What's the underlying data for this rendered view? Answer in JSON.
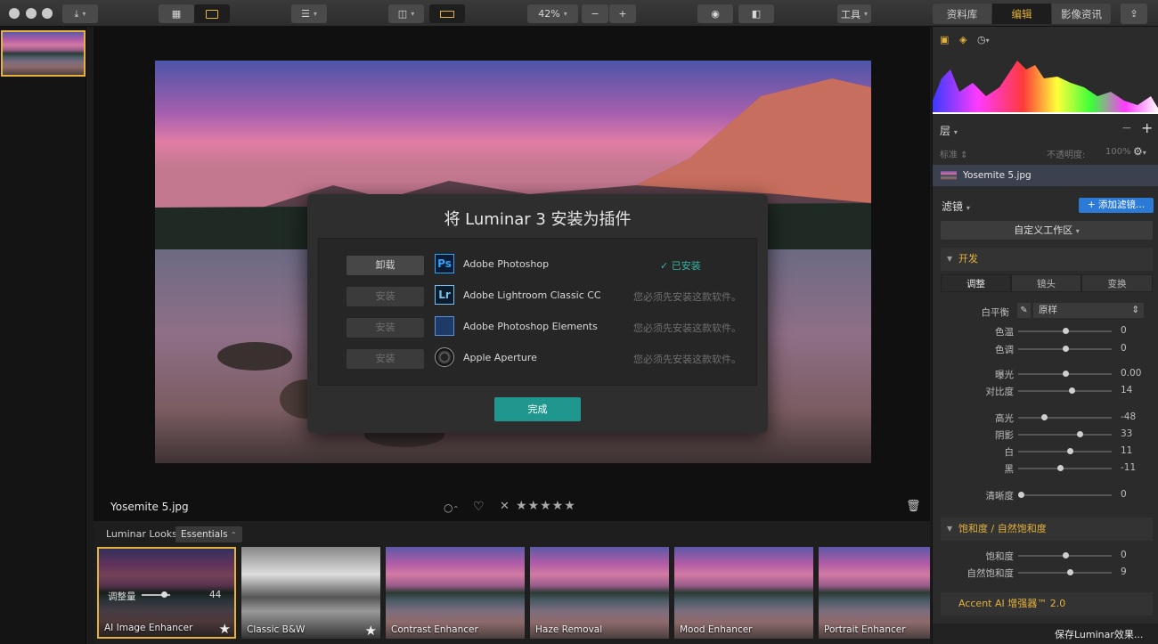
{
  "toolbar": {
    "zoom": "42%",
    "tools_label": "工具",
    "tabs": [
      "资料库",
      "编辑",
      "影像资讯"
    ]
  },
  "image": {
    "filename": "Yosemite 5.jpg"
  },
  "dialog": {
    "title": "将 Luminar 3 安装为插件",
    "rows": [
      {
        "button": "卸载",
        "icon": "Ps",
        "name": "Adobe Photoshop",
        "status": "✓ 已安装"
      },
      {
        "button": "安装",
        "icon": "Lr",
        "name": "Adobe Lightroom Classic CC",
        "status": "您必须先安装这款软件。"
      },
      {
        "button": "安装",
        "icon": "PSE",
        "name": "Adobe Photoshop Elements",
        "status": "您必须先安装这款软件。"
      },
      {
        "button": "安装",
        "icon": "AP",
        "name": "Apple Aperture",
        "status": "您必须先安装这款软件。"
      }
    ],
    "done": "完成"
  },
  "looks": {
    "label": "Luminar Looks:",
    "category": "Essentials",
    "amount_label": "调整量",
    "amount_value": "44",
    "amount_fraction": 0.44,
    "items": [
      {
        "name": "AI Image Enhancer"
      },
      {
        "name": "Classic B&W"
      },
      {
        "name": "Contrast Enhancer"
      },
      {
        "name": "Haze Removal"
      },
      {
        "name": "Mood Enhancer"
      },
      {
        "name": "Portrait Enhancer"
      }
    ]
  },
  "right": {
    "layers_label": "层",
    "blend_mode": "标准",
    "opacity_label": "不透明度:",
    "opacity_value": "100%",
    "layer_name": "Yosemite 5.jpg",
    "filters_label": "滤镜",
    "add_filter": "+ 添加滤镜...",
    "workspace": "自定义工作区",
    "develop": {
      "title": "开发",
      "tabs": [
        "调整",
        "镜头",
        "变换"
      ],
      "wb_label": "白平衡",
      "wb_value": "原样",
      "sliders": [
        {
          "label": "色温",
          "value": "0",
          "pos": 0.5
        },
        {
          "label": "色调",
          "value": "0",
          "pos": 0.5
        },
        {
          "label": "曝光",
          "value": "0.00",
          "pos": 0.5
        },
        {
          "label": "对比度",
          "value": "14",
          "pos": 0.57
        },
        {
          "label": "高光",
          "value": "-48",
          "pos": 0.26
        },
        {
          "label": "阴影",
          "value": "33",
          "pos": 0.66
        },
        {
          "label": "白",
          "value": "11",
          "pos": 0.55
        },
        {
          "label": "黑",
          "value": "-11",
          "pos": 0.44
        },
        {
          "label": "清晰度",
          "value": "0",
          "pos": 0.0
        }
      ]
    },
    "saturation": {
      "title": "饱和度 / 自然饱和度",
      "sliders": [
        {
          "label": "饱和度",
          "value": "0",
          "pos": 0.5
        },
        {
          "label": "自然饱和度",
          "value": "9",
          "pos": 0.55
        }
      ]
    },
    "accent_title": "Accent AI 增强器™ 2.0",
    "save_looks": "保存Luminar效果..."
  },
  "colors": {
    "accent": "#e5b23a",
    "teal": "#1f978e",
    "blue": "#2a7ad6"
  }
}
